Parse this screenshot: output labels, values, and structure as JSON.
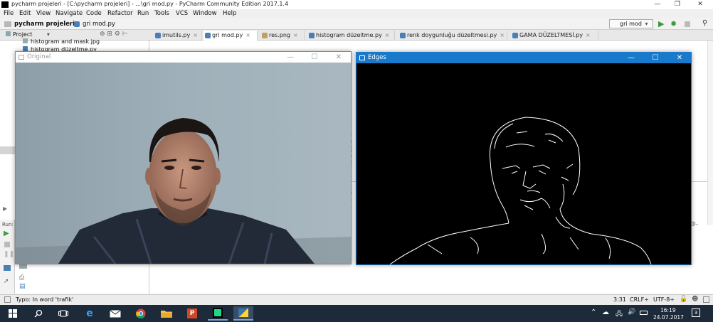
{
  "window": {
    "title": "pycharm projeleri - [C:\\pycharm projeleri] - ...\\gri mod.py - PyCharm Community Edition 2017.1.4"
  },
  "menu": [
    "File",
    "Edit",
    "View",
    "Navigate",
    "Code",
    "Refactor",
    "Run",
    "Tools",
    "VCS",
    "Window",
    "Help"
  ],
  "nav": {
    "project": "pycharm projeleri",
    "file": "gri mod.py",
    "run_config": "gri mod"
  },
  "project_panel": {
    "label": "Project",
    "files": [
      "histogram and mask.jpg",
      "histogram düzeltme.py"
    ]
  },
  "tabs": [
    {
      "label": "imutils.py"
    },
    {
      "label": "gri mod.py",
      "active": true
    },
    {
      "label": "res.png"
    },
    {
      "label": "histogram düzeltme.py"
    },
    {
      "label": "renk doygunluğu düzeltmesi.py"
    },
    {
      "label": "GAMA DÜZELTMESİ.py"
    }
  ],
  "run_panel": {
    "label": "Run:"
  },
  "status": {
    "message": "Typo: In word 'trafik'",
    "position": "3:31",
    "line_sep": "CRLF÷",
    "encoding": "UTF-8÷"
  },
  "windows": {
    "original": {
      "title": "Original"
    },
    "edges": {
      "title": "Edges"
    }
  },
  "taskbar": {
    "time": "16:19",
    "date": "24.07.2017",
    "notifications": "3"
  },
  "colors": {
    "accent": "#1979ca",
    "taskbar": "#1c2a3a"
  }
}
